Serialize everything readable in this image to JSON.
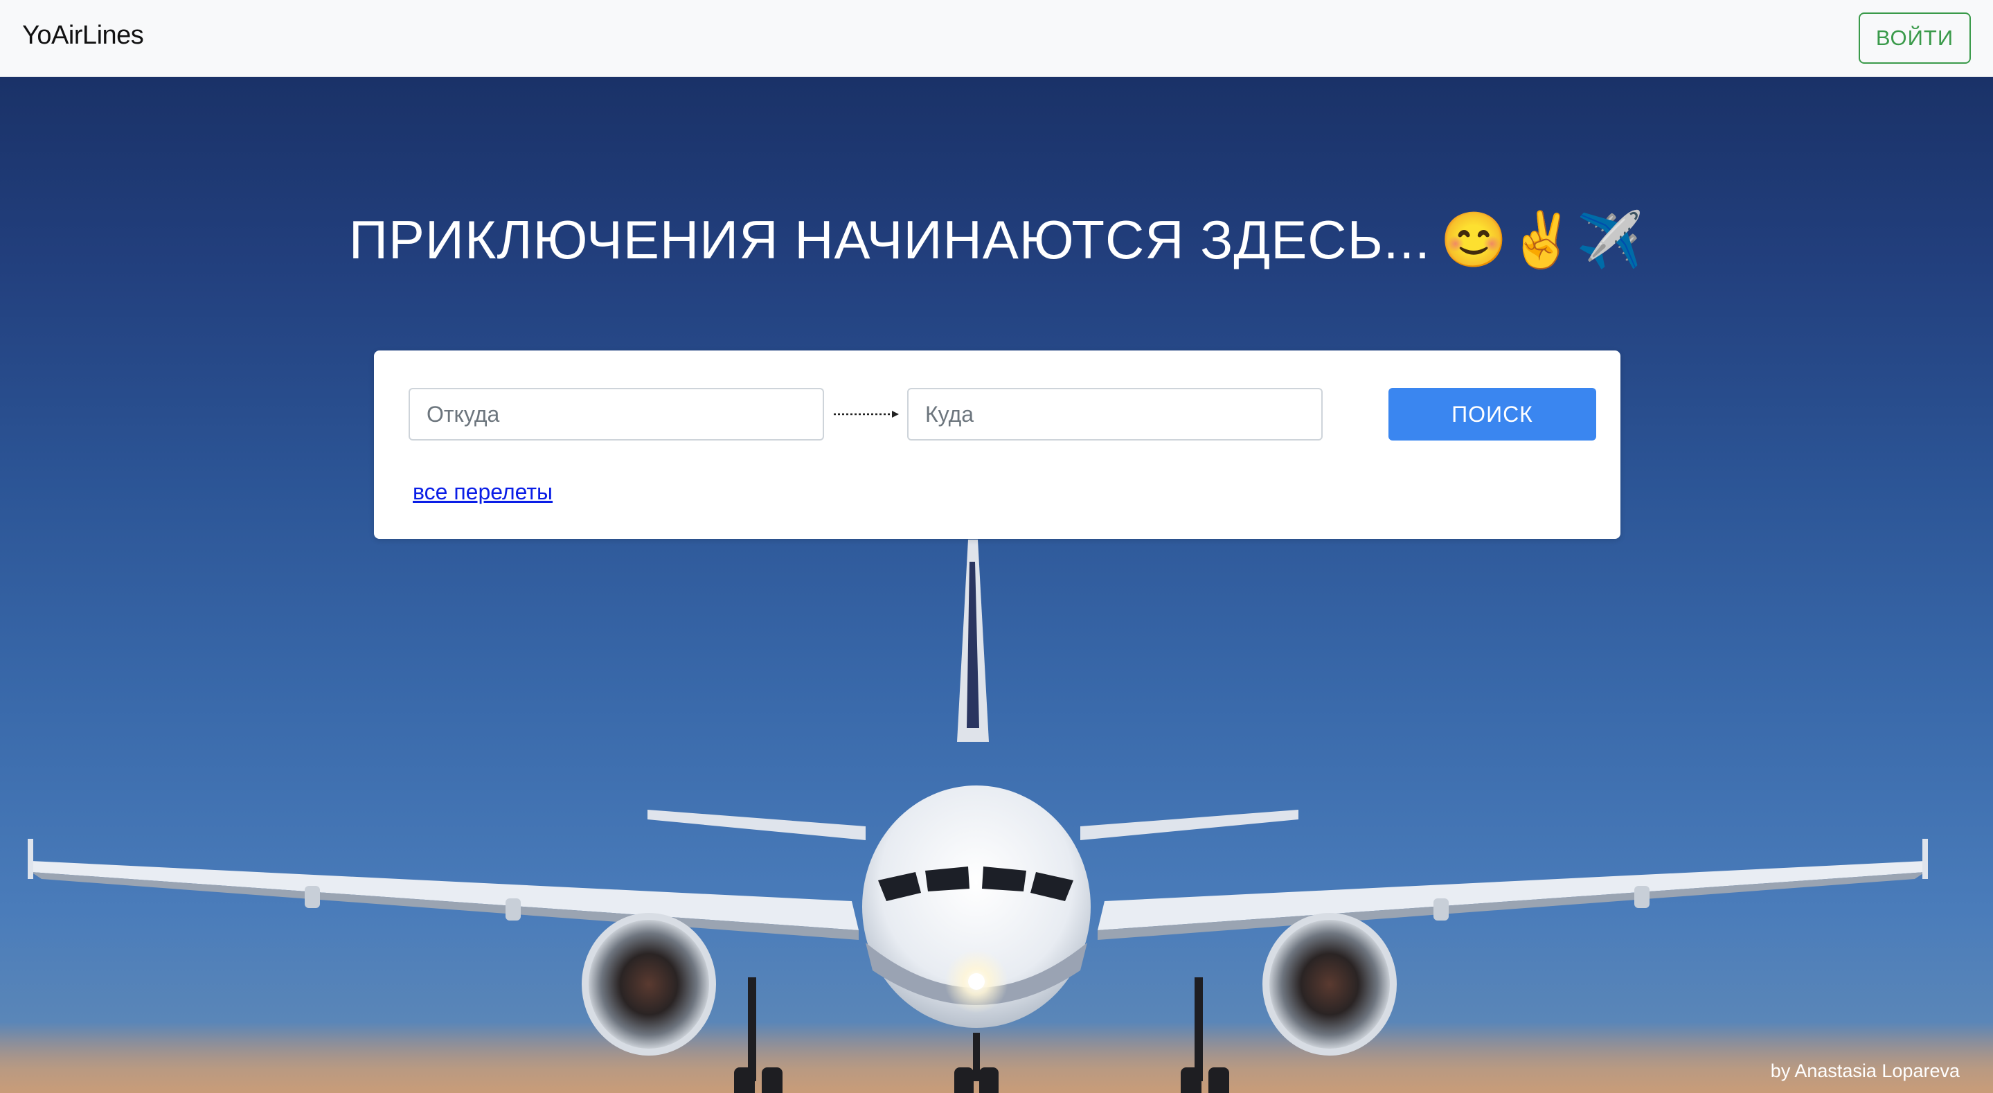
{
  "navbar": {
    "brand": "YoAirLines",
    "login_label": "ВОЙТИ"
  },
  "hero": {
    "title": "ПРИКЛЮЧЕНИЯ НАЧИНАЮТСЯ ЗДЕСЬ...",
    "emojis": "😊✌️✈️"
  },
  "search": {
    "from_placeholder": "Откуда",
    "to_placeholder": "Куда",
    "search_label": "ПОИСК",
    "all_flights_label": "все перелеты"
  },
  "footer": {
    "credit": "by Anastasia Lopareva"
  },
  "colors": {
    "login_accent": "#3a9a4a",
    "search_button": "#3a86f0",
    "link": "#0a1ee6",
    "sky_top": "#1a3268",
    "sky_bottom": "#4a7cba"
  }
}
